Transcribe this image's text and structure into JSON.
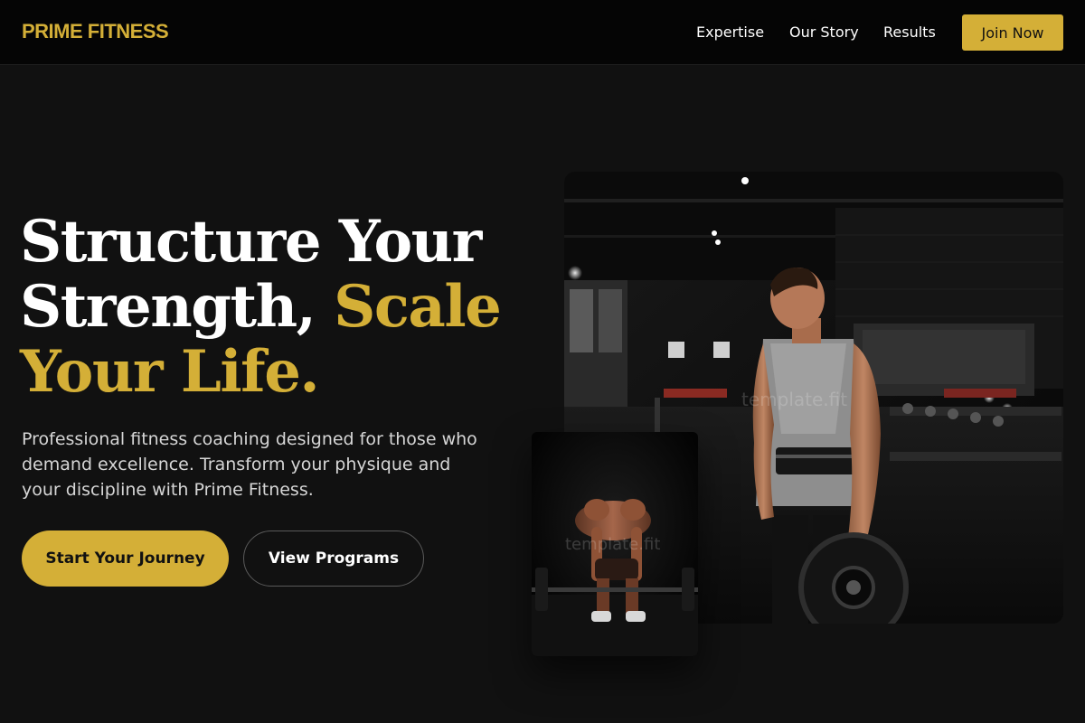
{
  "nav": {
    "logo": "PRIME FITNESS",
    "links": [
      "Expertise",
      "Our Story",
      "Results"
    ],
    "join_label": "Join Now"
  },
  "hero": {
    "title_line1": "Structure Your",
    "title_line2_white": "Strength, ",
    "title_line2_gold": "Scale",
    "title_line3_gold": "Your Life.",
    "description": "Professional fitness coaching designed for those who demand excellence. Transform your physique and your discipline with Prime Fitness.",
    "primary_button": "Start Your Journey",
    "secondary_button": "View Programs"
  },
  "images": {
    "main_alt": "Athlete in gym holding weight plate",
    "small_alt": "Athlete performing deadlift",
    "watermark": "template.fit"
  },
  "colors": {
    "accent": "#d4af37",
    "background": "#111111",
    "nav_background": "#050505"
  }
}
